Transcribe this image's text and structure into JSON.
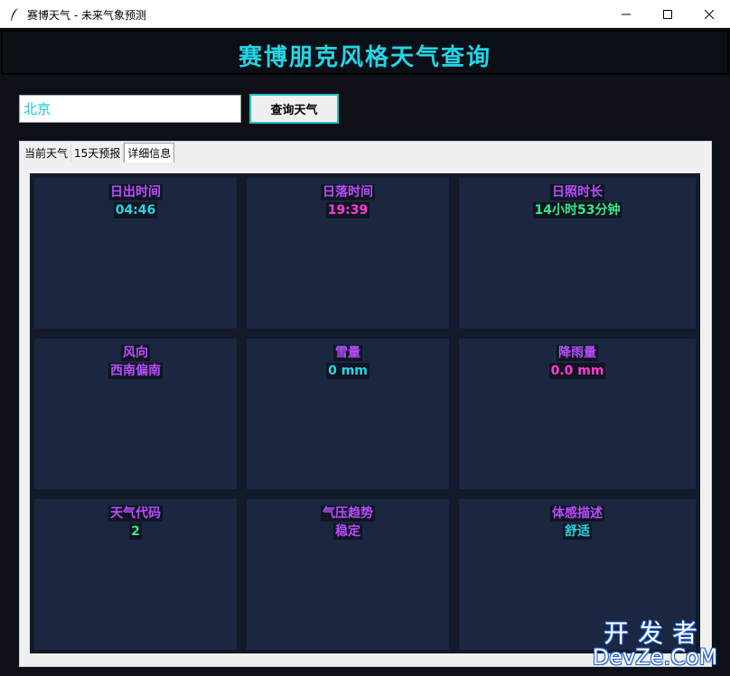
{
  "window": {
    "title": "赛博天气 - 未来气象预测",
    "icons": {
      "app": "feather-icon",
      "minimize": "minimize-icon",
      "maximize": "maximize-icon",
      "close": "close-icon"
    }
  },
  "header": {
    "title": "赛博朋克风格天气查询"
  },
  "search": {
    "city_value": "北京",
    "button_label": "查询天气"
  },
  "tabs": [
    {
      "label": "当前天气"
    },
    {
      "label": "15天预报"
    },
    {
      "label": "详细信息",
      "active": true
    }
  ],
  "details": [
    {
      "label": "日出时间",
      "value": "04:46",
      "value_color": "#22d8e6"
    },
    {
      "label": "日落时间",
      "value": "19:39",
      "value_color": "#ff3bd8"
    },
    {
      "label": "日照时长",
      "value": "14小时53分钟",
      "value_color": "#33ea8a"
    },
    {
      "label": "风向",
      "value": "西南偏南",
      "value_color": "#b74dff"
    },
    {
      "label": "雪量",
      "value": "0 mm",
      "value_color": "#22d8e6"
    },
    {
      "label": "降雨量",
      "value": "0.0 mm",
      "value_color": "#ff3bd8"
    },
    {
      "label": "天气代码",
      "value": "2",
      "value_color": "#33ea8a"
    },
    {
      "label": "气压趋势",
      "value": "稳定",
      "value_color": "#b74dff"
    },
    {
      "label": "体感描述",
      "value": "舒适",
      "value_color": "#22d8e6"
    }
  ],
  "colors": {
    "label": "#b74dff",
    "accent": "#22d6e4",
    "background": "#0d1117",
    "cell": "#1b2740"
  },
  "watermark": {
    "line1": "开发者",
    "line2": "DevZe.CoM"
  }
}
